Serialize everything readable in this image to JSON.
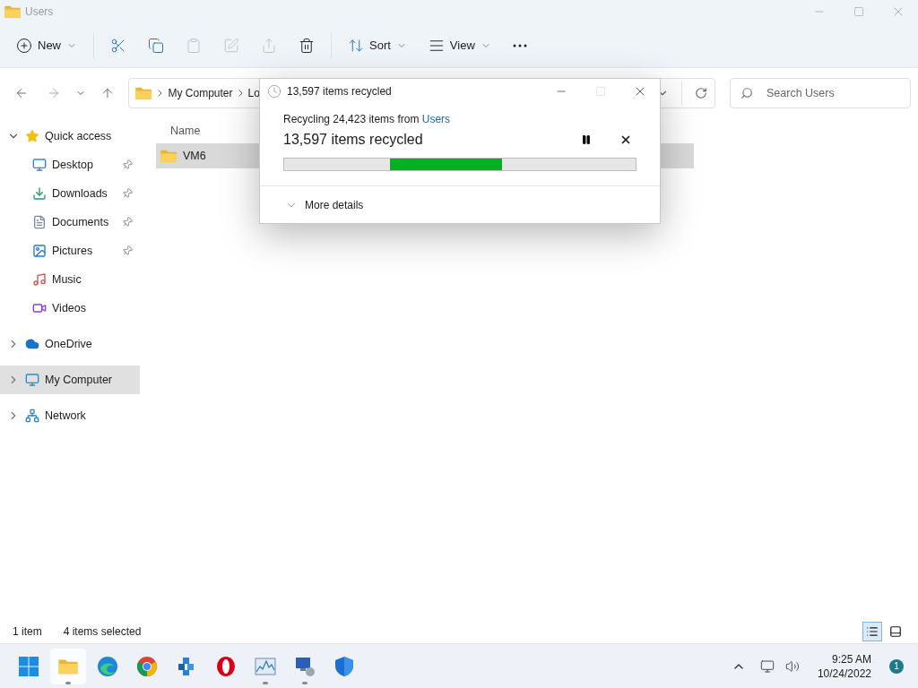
{
  "window": {
    "title": "Users"
  },
  "toolbar": [
    {
      "kind": "new",
      "label": "New",
      "disabled": false
    },
    {
      "kind": "cut",
      "disabled": false
    },
    {
      "kind": "copy",
      "disabled": false
    },
    {
      "kind": "paste",
      "disabled": true
    },
    {
      "kind": "rename",
      "disabled": true
    },
    {
      "kind": "share",
      "disabled": true
    },
    {
      "kind": "delete",
      "disabled": false
    },
    {
      "kind": "sort",
      "label": "Sort",
      "disabled": false
    },
    {
      "kind": "view",
      "label": "View",
      "disabled": false
    },
    {
      "kind": "more",
      "disabled": false
    }
  ],
  "address": {
    "crumbs": [
      "My Computer",
      "Lo"
    ]
  },
  "search": {
    "placeholder": "Search Users"
  },
  "sidebar": {
    "items": [
      {
        "label": "Quick access",
        "kind": "star",
        "expanded": true,
        "selected": false,
        "children": [
          {
            "label": "Desktop",
            "kind": "desktop",
            "pinned": true,
            "selected": false
          },
          {
            "label": "Downloads",
            "kind": "download",
            "pinned": true,
            "selected": false
          },
          {
            "label": "Documents",
            "kind": "document",
            "pinned": true,
            "selected": false
          },
          {
            "label": "Pictures",
            "kind": "pictures",
            "pinned": true,
            "selected": false
          },
          {
            "label": "Music",
            "kind": "music",
            "pinned": false,
            "selected": false
          },
          {
            "label": "Videos",
            "kind": "videos",
            "pinned": false,
            "selected": false
          }
        ]
      },
      {
        "label": "OneDrive",
        "kind": "cloud",
        "expanded": false,
        "selected": false
      },
      {
        "label": "My Computer",
        "kind": "computer",
        "expanded": false,
        "selected": true
      },
      {
        "label": "Network",
        "kind": "network",
        "expanded": false,
        "selected": false
      }
    ]
  },
  "table": {
    "columns": [
      "Name"
    ],
    "rows": [
      {
        "name": "VM6",
        "selected": true
      }
    ]
  },
  "status_bar": {
    "count": "1 item",
    "selection": "4 items selected",
    "details_view": true
  },
  "dialog": {
    "title": "13,597 items recycled",
    "line": "Recycling 24,423 items from ",
    "source": "Users",
    "heading": "13,597 items recycled",
    "more": "More details"
  },
  "taskbar": {
    "apps": [
      {
        "kind": "start",
        "running": false
      },
      {
        "kind": "explorer",
        "running": true
      },
      {
        "kind": "edge",
        "running": false
      },
      {
        "kind": "chrome",
        "running": false
      },
      {
        "kind": "cubes",
        "running": false
      },
      {
        "kind": "opera",
        "running": false
      },
      {
        "kind": "monitor",
        "running": true
      },
      {
        "kind": "remote",
        "running": true
      },
      {
        "kind": "shield",
        "running": false
      }
    ],
    "time": "9:25 AM",
    "date": "10/24/2022",
    "badge": "1"
  }
}
